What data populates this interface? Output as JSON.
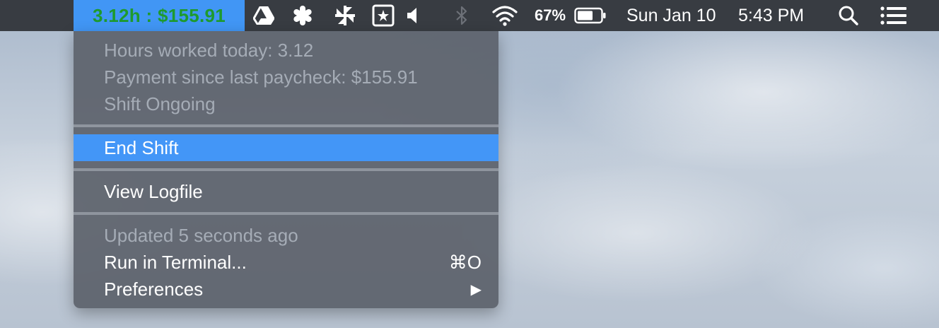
{
  "menubar": {
    "app_status": "3.12h : $155.91",
    "icons": [
      "google-drive-icon",
      "asterisk-app-icon",
      "pinwheel-app-icon",
      "star-box-app-icon",
      "volume-icon",
      "bluetooth-icon",
      "wifi-icon",
      "battery-icon",
      "spotlight-search-icon",
      "notification-center-icon"
    ],
    "battery_percent": "67%",
    "date": "Sun Jan 10",
    "time": "5:43 PM"
  },
  "menu": {
    "info": {
      "hours": "Hours worked today: 3.12",
      "payment": "Payment since last paycheck: $155.91",
      "status": "Shift Ongoing"
    },
    "end_shift": "End Shift",
    "view_logfile": "View Logfile",
    "updated": "Updated 5 seconds ago",
    "run_terminal": "Run in Terminal...",
    "run_terminal_shortcut": "⌘O",
    "preferences": "Preferences",
    "preferences_arrow": "▶"
  },
  "colors": {
    "menubar_bg": "#383c42",
    "status_bg": "#4196f5",
    "status_text": "#1e9a2e",
    "highlight": "#4396f7",
    "menu_bg": "#5c626c",
    "disabled_text": "#a5acb6"
  }
}
